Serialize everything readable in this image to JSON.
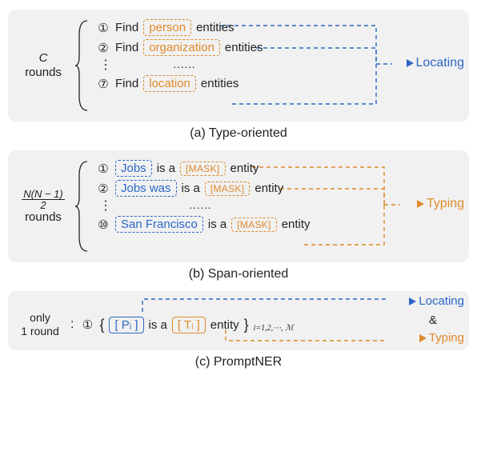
{
  "panel_a": {
    "rounds_label_top": "C",
    "rounds_label_bottom": "rounds",
    "items": [
      {
        "num": "①",
        "pre": "Find",
        "entity": "person",
        "post": "entities"
      },
      {
        "num": "②",
        "pre": "Find",
        "entity": "organization",
        "post": "entities"
      },
      {
        "num": "⑦",
        "pre": "Find",
        "entity": "location",
        "post": "entities"
      }
    ],
    "hdots": "……",
    "result": "Locating",
    "caption": "(a) Type-oriented"
  },
  "panel_b": {
    "frac_num": "N(N − 1)",
    "frac_den": "2",
    "rounds_label": "rounds",
    "items": [
      {
        "num": "①",
        "span": "Jobs",
        "mid": "is a",
        "mask": "[MASK]",
        "post": "entity"
      },
      {
        "num": "②",
        "span": "Jobs was",
        "mid": "is a",
        "mask": "[MASK]",
        "post": "entity"
      },
      {
        "num": "⑩",
        "span": "San Francisco",
        "mid": "is a",
        "mask": "[MASK]",
        "post": "entity"
      }
    ],
    "hdots": "……",
    "result": "Typing",
    "caption": "(b) Span-oriented"
  },
  "panel_c": {
    "left_top": "only",
    "left_bottom": "1 round",
    "num": "①",
    "lbrace": "{",
    "p_token": "[ Pᵢ ]",
    "mid": "is a",
    "t_token": "[ Tᵢ ]",
    "post": "entity",
    "rbrace": "}",
    "subscript": "i=1,2,⋯, ℳ",
    "result_top": "Locating",
    "result_amp": "&",
    "result_bottom": "Typing",
    "caption": "(c) PromptNER"
  },
  "chart_data": {
    "type": "table",
    "title": "Prompt-based NER decoding schemes",
    "rows": [
      {
        "scheme": "Type-oriented",
        "rounds": "C",
        "prompt_template": "Find <type> entities",
        "example_slots": [
          "person",
          "organization",
          "…",
          "location"
        ],
        "output": "Locating"
      },
      {
        "scheme": "Span-oriented",
        "rounds": "N(N−1)/2",
        "prompt_template": "<span> is a [MASK] entity",
        "example_slots": [
          "Jobs",
          "Jobs was",
          "…",
          "San Francisco"
        ],
        "output": "Typing"
      },
      {
        "scheme": "PromptNER",
        "rounds": "1",
        "prompt_template": "{ [Pᵢ] is a [Tᵢ] entity }_{i=1..M}",
        "example_slots": [],
        "output": "Locating & Typing"
      }
    ]
  }
}
